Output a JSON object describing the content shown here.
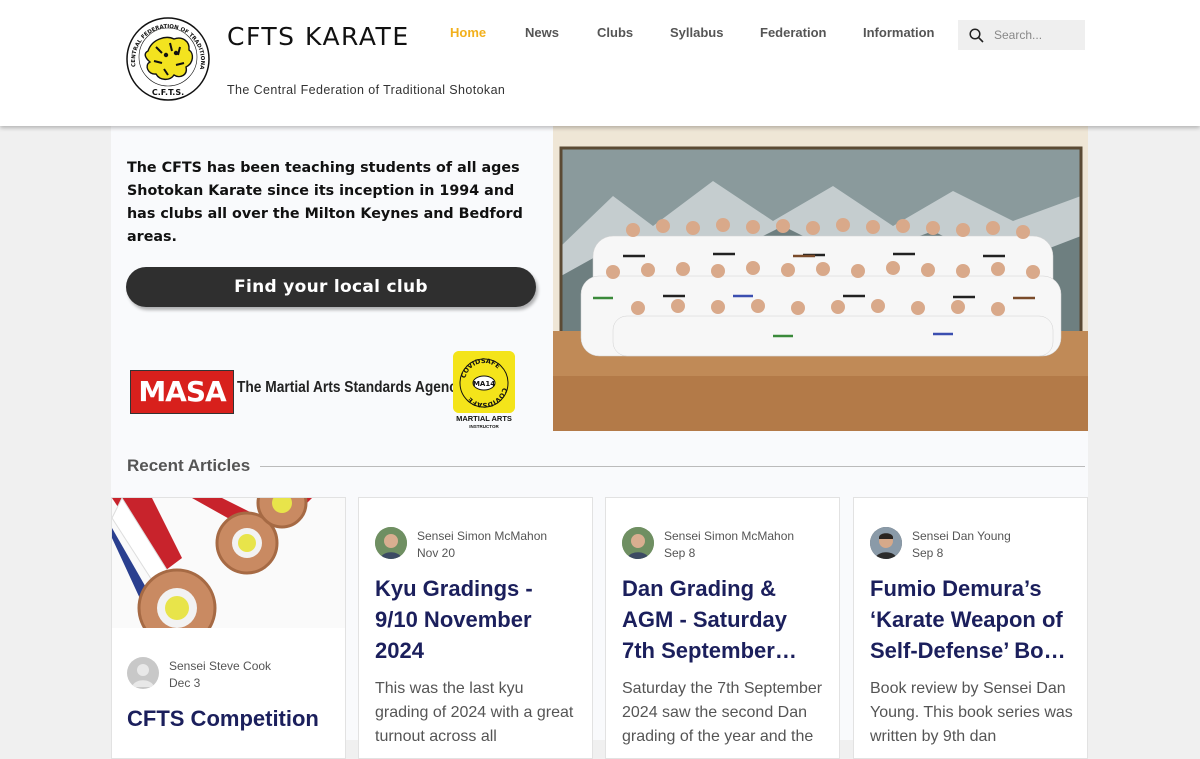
{
  "header": {
    "site_title": "CFTS KARATE",
    "tagline": "The Central Federation of Traditional Shotokan",
    "logo_ring_text": "CENTRAL FEDERATION OF TRADITIONAL SHOTOKAN",
    "logo_bottom_text": "C.F.T.S.",
    "nav": [
      {
        "label": "Home",
        "active": true
      },
      {
        "label": "News",
        "active": false
      },
      {
        "label": "Clubs",
        "active": false
      },
      {
        "label": "Syllabus",
        "active": false
      },
      {
        "label": "Federation",
        "active": false
      },
      {
        "label": "Information",
        "active": false
      }
    ],
    "search_placeholder": "Search...",
    "search_icon": "search-icon",
    "active_color": "#f2b01c"
  },
  "intro": {
    "text": "The CFTS has been teaching students of all ages Shotokan Karate since its inception in 1994 and has clubs all over the Milton Keynes and Bedford areas.",
    "cta_label": "Find your local club"
  },
  "logos": {
    "masa_short": "MASA",
    "masa_full": "The Martial Arts Standards Agency",
    "covid_ring": "COVIDSAFE",
    "covid_center": "MA14",
    "covid_caption": "MARTIAL ARTS",
    "covid_sub": "INSTRUCTOR"
  },
  "recent": {
    "title": "Recent Articles",
    "articles": [
      {
        "author": "Sensei Steve Cook",
        "date": "Dec 3",
        "title": "CFTS Competition",
        "excerpt": "",
        "has_image": true
      },
      {
        "author": "Sensei Simon McMahon",
        "date": "Nov 20",
        "title": "Kyu Gradings - 9/10 November 2024",
        "excerpt": "This was the last kyu grading of 2024 with a great turnout across all"
      },
      {
        "author": "Sensei Simon McMahon",
        "date": "Sep 8",
        "title": "Dan Grading & AGM - Saturday 7th September…",
        "excerpt": "Saturday the 7th September 2024 saw the second Dan grading of the year and the"
      },
      {
        "author": "Sensei Dan Young",
        "date": "Sep 8",
        "title": "Fumio Demura’s ‘Karate Weapon of Self-Defense’ Bo…",
        "excerpt": "Book review by Sensei Dan Young. This book series was written by 9th dan"
      }
    ]
  },
  "colors": {
    "title_navy": "#1b1f5c",
    "cta_dark": "#2f2f2f",
    "masa_red": "#d8201c",
    "covid_yellow": "#f4e41a"
  }
}
